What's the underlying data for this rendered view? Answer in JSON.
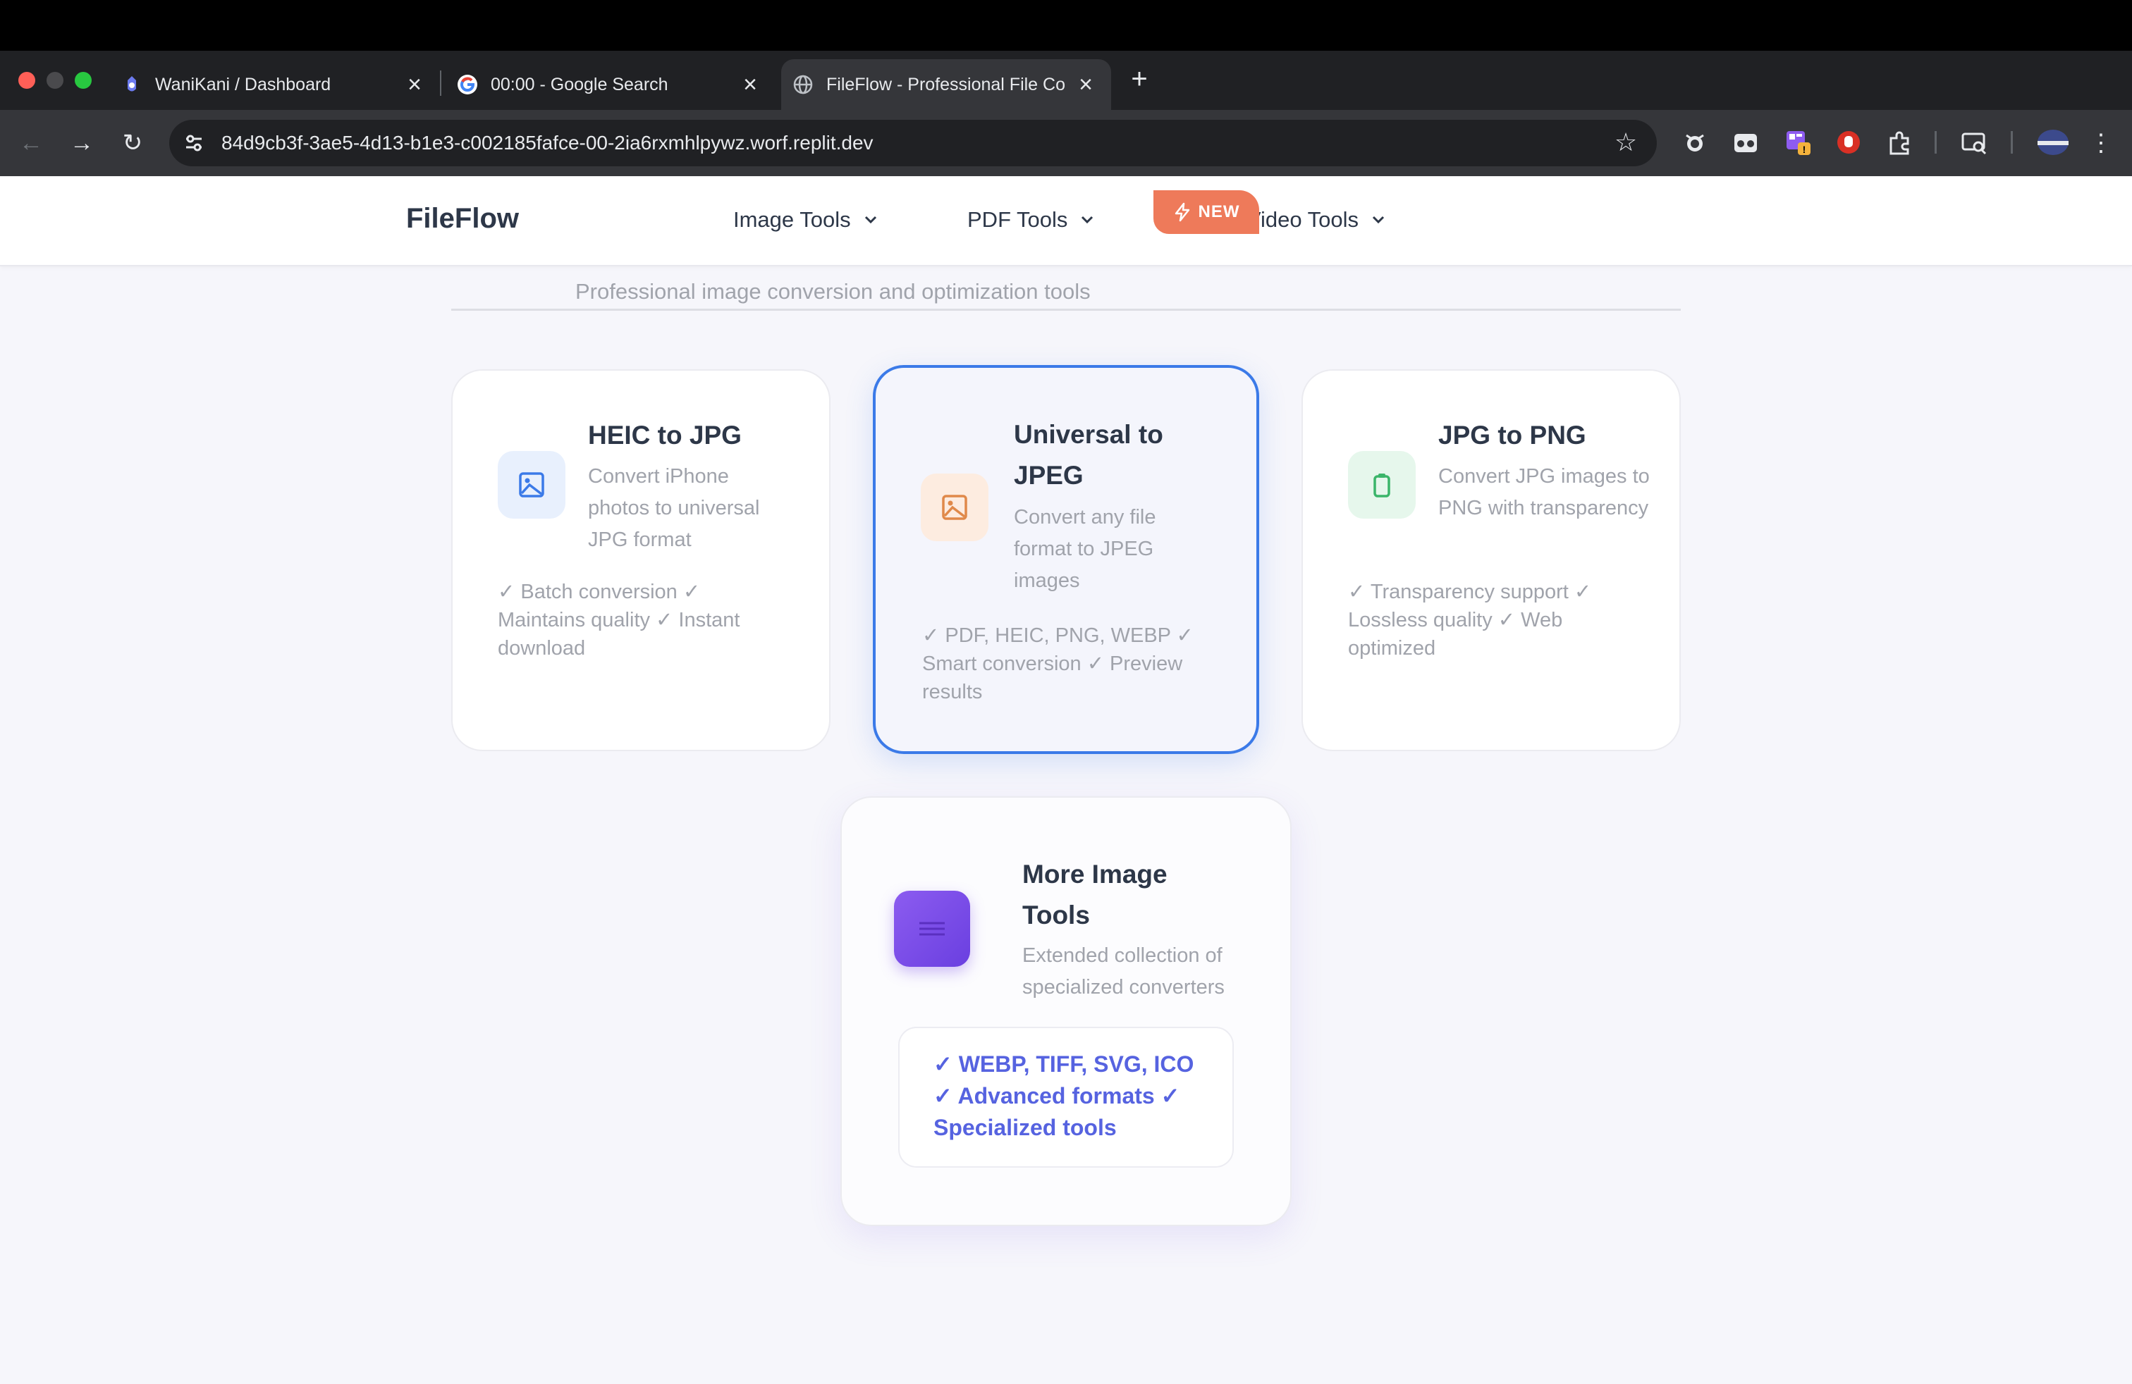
{
  "browser": {
    "tabs": [
      {
        "title": "WaniKani / Dashboard",
        "favicon": "wanikani-favicon",
        "active": false
      },
      {
        "title": "00:00 - Google Search",
        "favicon": "google-favicon",
        "active": false
      },
      {
        "title": "FileFlow - Professional File Co",
        "favicon": "globe-favicon",
        "active": true
      }
    ],
    "url": "84d9cb3f-3ae5-4d13-b1e3-c002185fafce-00-2ia6rxmhlpywz.worf.replit.dev",
    "close_glyph": "×",
    "new_tab_glyph": "+",
    "back_glyph": "←",
    "forward_glyph": "→",
    "reload_glyph": "↻",
    "bookmark_glyph": "☆",
    "menu_glyph": "⋮"
  },
  "site": {
    "brand": "FileFlow",
    "nav": [
      {
        "label": "Image Tools"
      },
      {
        "label": "PDF Tools"
      },
      {
        "label": "Audio/Video Tools"
      }
    ],
    "subtitle": "Professional image conversion and optimization tools"
  },
  "cards": {
    "heic": {
      "title": "HEIC to JPG",
      "description": "Convert iPhone photos to universal JPG format",
      "features": "✓ Batch conversion ✓ Maintains quality ✓ Instant download",
      "icon": "image-icon",
      "accent": "#3b7ae8"
    },
    "universal": {
      "title": "Universal to JPEG",
      "description": "Convert any file format to JPEG images",
      "features": "✓ PDF, HEIC, PNG, WEBP ✓ Smart conversion ✓ Preview results",
      "badge": "NEW",
      "icon": "image-icon",
      "accent": "#e0894a"
    },
    "jpg_png": {
      "title": "JPG to PNG",
      "description": "Convert JPG images to PNG with transparency",
      "features": "✓ Transparency support ✓ Lossless quality ✓ Web optimized",
      "icon": "clipboard-icon",
      "accent": "#3bb56a"
    },
    "more": {
      "title": "More Image Tools",
      "description": "Extended collection of specialized converters",
      "features": "✓ WEBP, TIFF, SVG, ICO ✓ Advanced formats ✓ Specialized tools",
      "icon": "menu-lines-icon",
      "accent": "#7b4ee8"
    }
  }
}
